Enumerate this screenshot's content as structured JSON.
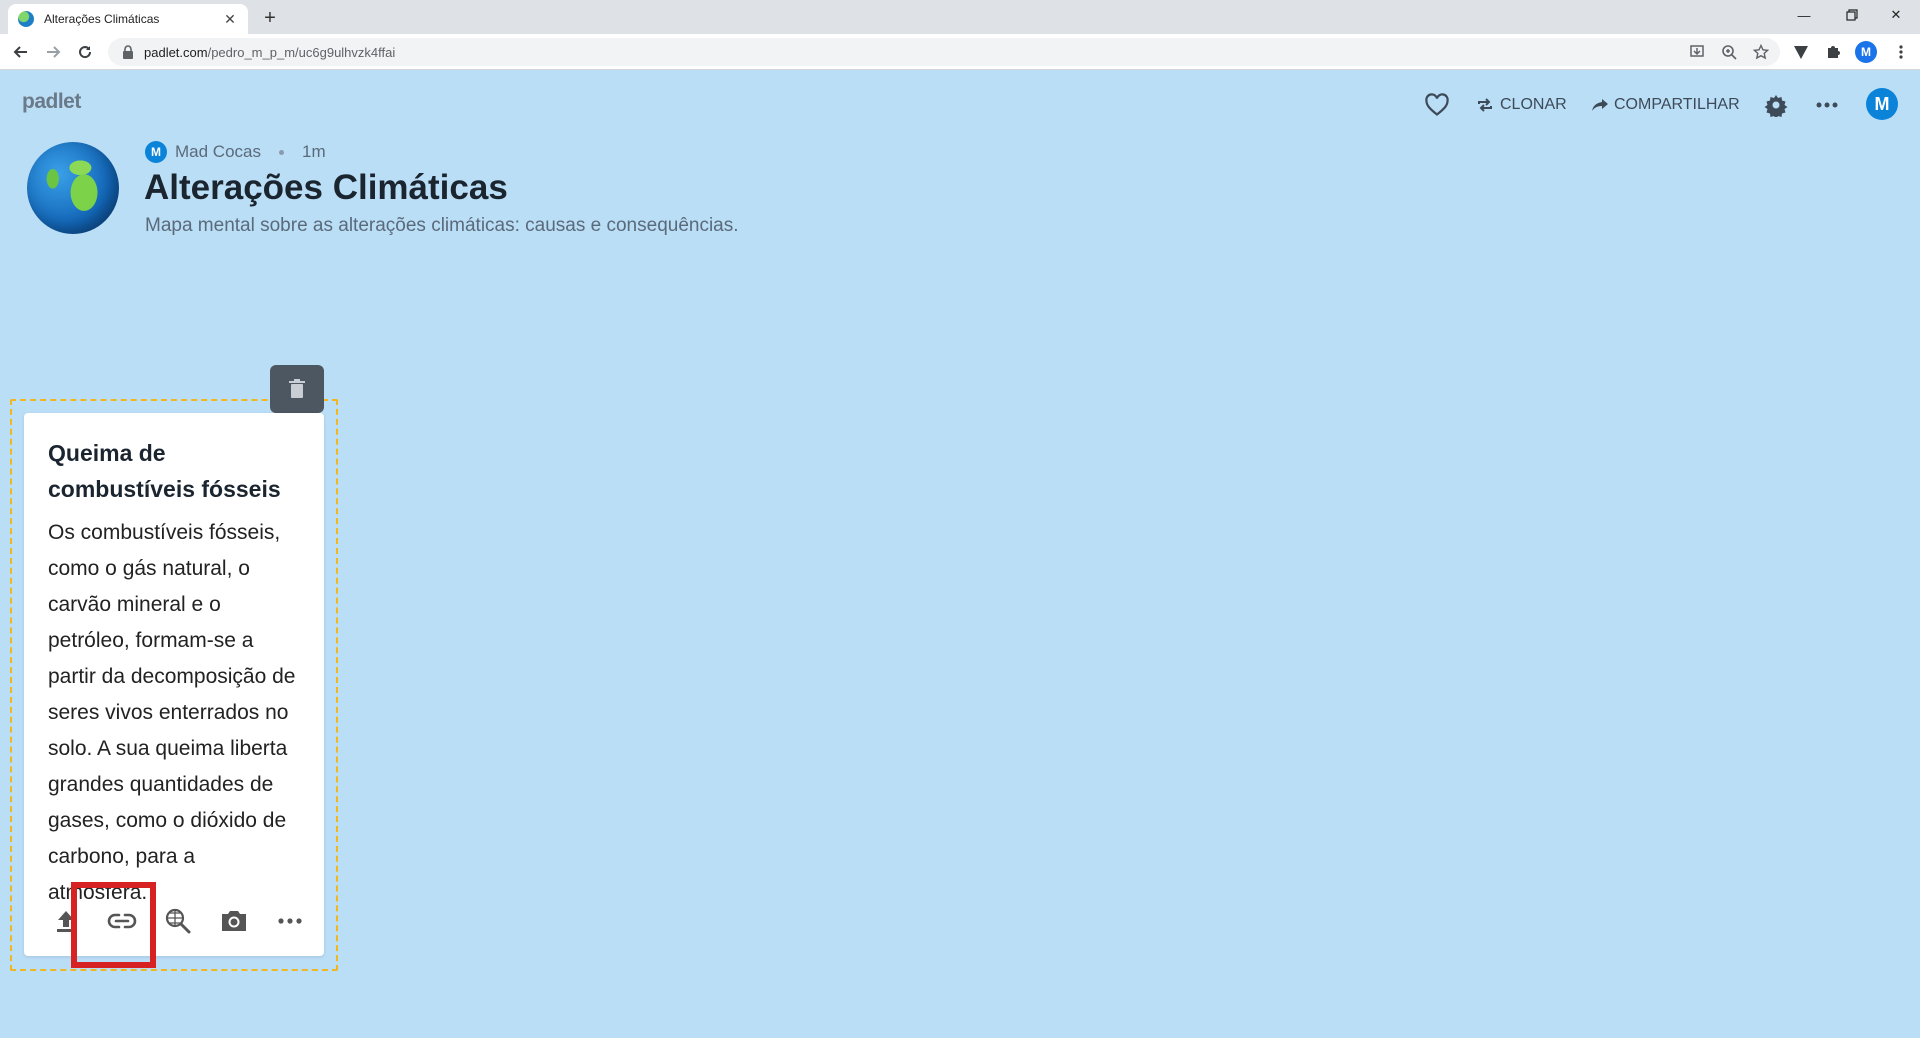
{
  "browser": {
    "tab_title": "Alterações Climáticas",
    "url_host": "padlet.com",
    "url_path": "/pedro_m_p_m/uc6g9ulhvzk4ffai",
    "profile_initial": "M"
  },
  "header": {
    "logo": "padlet",
    "clone_label": "CLONAR",
    "share_label": "COMPARTILHAR",
    "avatar_initial": "M"
  },
  "board": {
    "author_initial": "M",
    "author": "Mad Cocas",
    "time": "1m",
    "title": "Alterações Climáticas",
    "description": "Mapa mental sobre as alterações climáticas: causas e consequências."
  },
  "post": {
    "title": "Queima de combustíveis fósseis",
    "body": "Os combustíveis fósseis, como o gás natural, o carvão mineral e o petróleo, formam-se a partir da decomposição de seres vivos enterrados no solo. A sua queima liberta grandes quantidades de gases, como o dióxido de carbono, para a atmosfera."
  },
  "colors": {
    "background": "#bbdef7",
    "selection_border": "#f1b71e",
    "highlight": "#d62222",
    "avatar": "#0b83d9"
  }
}
